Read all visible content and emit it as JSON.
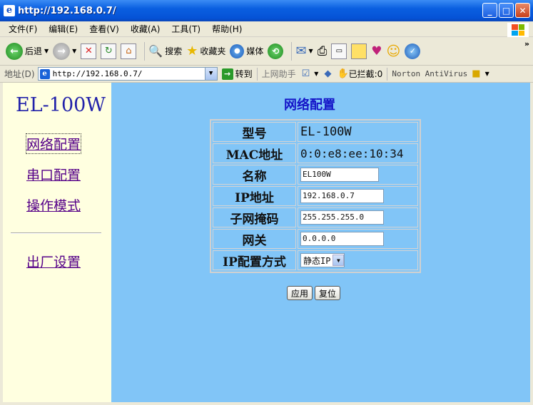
{
  "window": {
    "title": "http://192.168.0.7/"
  },
  "menubar": [
    "文件(F)",
    "编辑(E)",
    "查看(V)",
    "收藏(A)",
    "工具(T)",
    "帮助(H)"
  ],
  "toolbar": {
    "back": "后退",
    "search": "搜索",
    "favorites": "收藏夹",
    "media": "媒体"
  },
  "addressbar": {
    "label": "地址(D)",
    "url": "http://192.168.0.7/",
    "go": "转到",
    "helper": "上网助手",
    "blocked": "已拦截:0",
    "norton": "Norton AntiVirus"
  },
  "nav": {
    "brand": "EL-100W",
    "items": [
      "网络配置",
      "串口配置",
      "操作模式"
    ],
    "factory": "出厂设置"
  },
  "page": {
    "title": "网络配置",
    "rows": [
      {
        "label": "型号",
        "value": "EL-100W"
      },
      {
        "label": "MAC地址",
        "value": "0:0:e8:ee:10:34"
      },
      {
        "label": "名称",
        "value": "EL100W"
      },
      {
        "label": "IP地址",
        "value": "192.168.0.7"
      },
      {
        "label": "子网掩码",
        "value": "255.255.255.0"
      },
      {
        "label": "网关",
        "value": "0.0.0.0"
      },
      {
        "label": "IP配置方式",
        "value": "静态IP"
      }
    ],
    "apply": "应用",
    "reset": "复位"
  }
}
